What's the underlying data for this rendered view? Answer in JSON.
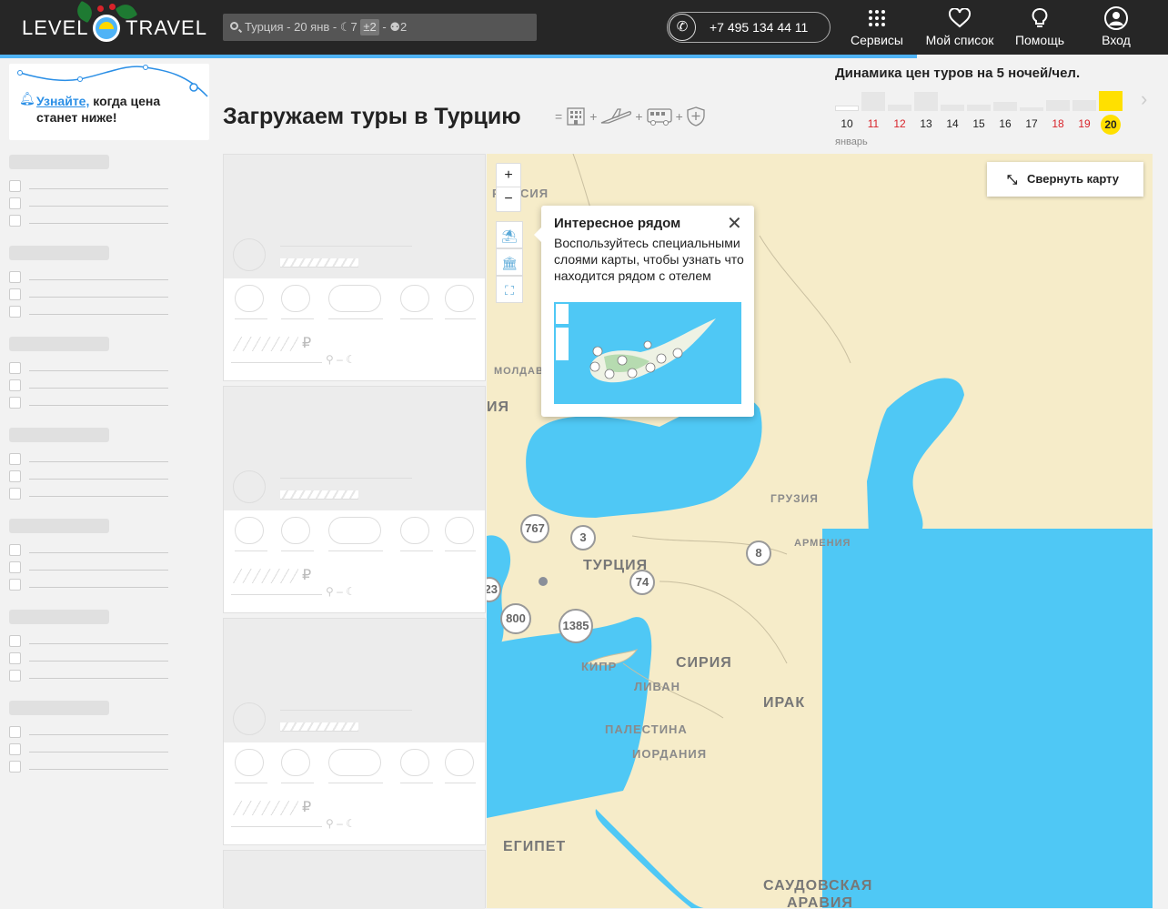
{
  "header": {
    "logo_left": "LEVEL",
    "logo_right": "TRAVEL",
    "search": {
      "destination": "Турция - 20 янв -",
      "nights": "7",
      "nights_flex": "±2",
      "sep": "-",
      "people": "2"
    },
    "phone": "+7 495 134 44 11",
    "nav": [
      {
        "label": "Сервисы",
        "icon": "grid-icon"
      },
      {
        "label": "Мой список",
        "icon": "heart-icon"
      },
      {
        "label": "Помощь",
        "icon": "lightbulb-icon"
      },
      {
        "label": "Вход",
        "icon": "user-icon"
      }
    ]
  },
  "notify": {
    "link": "Узнайте,",
    "text_rest": "когда цена",
    "text_line2": "станет ниже!"
  },
  "main": {
    "heading": "Загружаем туры в Турцию",
    "includes_icons": [
      "hotel-icon",
      "plane-icon",
      "bus-icon",
      "shield-icon"
    ]
  },
  "price_dynamics": {
    "title": "Динамика цен туров на 5 ночей/чел.",
    "month": "январь",
    "selected_day": "20",
    "days": [
      {
        "day": "10",
        "red": false,
        "level": 0.25,
        "empty": true
      },
      {
        "day": "11",
        "red": true,
        "level": 0.95
      },
      {
        "day": "12",
        "red": true,
        "level": 0.3
      },
      {
        "day": "13",
        "red": false,
        "level": 0.95
      },
      {
        "day": "14",
        "red": false,
        "level": 0.3
      },
      {
        "day": "15",
        "red": false,
        "level": 0.3
      },
      {
        "day": "16",
        "red": false,
        "level": 0.45
      },
      {
        "day": "17",
        "red": false,
        "level": 0.2
      },
      {
        "day": "18",
        "red": true,
        "level": 0.55
      },
      {
        "day": "19",
        "red": true,
        "level": 0.55
      },
      {
        "day": "20",
        "red": false,
        "level": 1.0,
        "selected": true
      }
    ]
  },
  "map": {
    "collapse_label": "Свернуть карту",
    "zoom_in": "+",
    "zoom_out": "−",
    "popup": {
      "title": "Интересное рядом",
      "description": "Воспользуйтесь специальными слоями карты, чтобы узнать что находится рядом с отелем"
    },
    "labels": [
      "РОССИЯ",
      "МОЛДАВ",
      "ИЯ",
      "ГРУЗИЯ",
      "АРМЕНИЯ",
      "ТУРЦИЯ",
      "СИРИЯ",
      "ИРАК",
      "КИПР",
      "ЛИВАН",
      "ПАЛЕСТИНА",
      "ИОРДАНИЯ",
      "ЕГИПЕТ",
      "САУДОВСКАЯ",
      "АРАВИЯ"
    ],
    "clusters": [
      "767",
      "3",
      "8",
      "74",
      "23",
      "800",
      "1385"
    ]
  },
  "colors": {
    "accent": "#2b8fe6",
    "header_bg": "#262626",
    "sea": "#4fc8f5",
    "land": "#f6ecc9",
    "highlight": "#ffe000"
  }
}
